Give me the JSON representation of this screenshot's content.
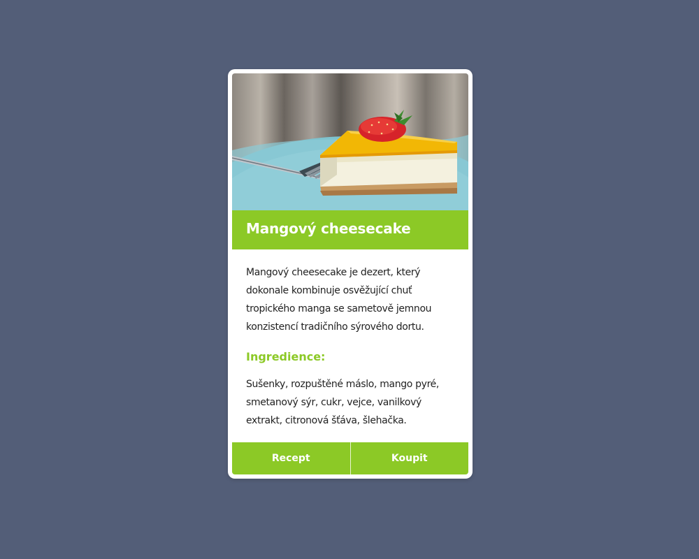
{
  "card": {
    "image_alt": "Mangový cheesecake",
    "title": "Mangový cheesecake",
    "description": "Mangový cheesecake je dezert, který dokonale kombinuje osvěžující chuť tropického manga se sametově jemnou konzistencí tradičního sýrového dortu.",
    "ingredients_heading": "Ingredience:",
    "ingredients": "Sušenky, rozpuštěné máslo, mango pyré, smetanový sýr, cukr, vejce, vanilkový extrakt, citronová šťáva, šlehačka.",
    "buttons": {
      "recipe_label": "Recept",
      "buy_label": "Koupit"
    }
  },
  "colors": {
    "background": "#535e78",
    "accent": "#8cc926",
    "card": "#ffffff",
    "text": "#222222"
  }
}
